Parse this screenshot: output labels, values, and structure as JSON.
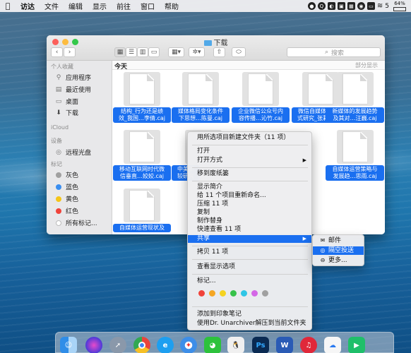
{
  "menubar": {
    "apple": "",
    "app": "访达",
    "items": [
      "文件",
      "编辑",
      "显示",
      "前往",
      "窗口",
      "帮助"
    ],
    "tray_battery_percent": "64%",
    "tray_number": "5"
  },
  "window": {
    "title": "下载",
    "search_placeholder": "搜索"
  },
  "sidebar": {
    "favorites_header": "个人收藏",
    "favorites": [
      "应用程序",
      "最近使用",
      "桌面",
      "下载"
    ],
    "icloud_header": "iCloud",
    "devices_header": "设备",
    "devices": [
      "远程光盘"
    ],
    "tags_header": "标记",
    "tags": [
      {
        "label": "灰色",
        "color": "#a0a0a0"
      },
      {
        "label": "蓝色",
        "color": "#3a8ef0"
      },
      {
        "label": "黄色",
        "color": "#f5c518"
      },
      {
        "label": "红色",
        "color": "#f0433a"
      },
      {
        "label": "所有标记...",
        "color": "#ffffff"
      }
    ]
  },
  "content": {
    "section_title": "今天",
    "section_part": "部分显示",
    "files": [
      [
        "结构_行为还是绩",
        "效_我国…李倩.caj"
      ],
      [
        "媒体格局变化条件",
        "下思想…陈曼.caj"
      ],
      [
        "企业微信公众号内",
        "容传播…沁竹.caj"
      ],
      [
        "微信自媒体运营模",
        "式研究_张莉芳.caj"
      ],
      [
        "新媒体的发展趋势",
        "及其对…汪巍.caj"
      ],
      [
        "移动互联网时代微",
        "信垂直…姣姣.caj"
      ],
      [
        "中美新",
        "较研究"
      ],
      [
        "自媒体运营策略与",
        "发展趋…思雨.caj"
      ],
      [
        "自媒体运营现状及",
        ""
      ]
    ]
  },
  "context_menu": {
    "items": [
      "用所选项目新建文件夹（11 项）",
      "打开",
      "打开方式",
      "移到废纸篓",
      "显示简介",
      "给 11 个项目重新命名...",
      "压缩 11 项",
      "复制",
      "制作替身",
      "快速查看 11 项",
      "共享",
      "拷贝 11 项",
      "查看显示选项",
      "标记...",
      "添加到印象笔记",
      "使用Dr. Unarchiver解压到当前文件夹"
    ],
    "tag_colors": [
      "#f0433a",
      "#f5a623",
      "#f5d320",
      "#37c24a",
      "#2fc6e6",
      "#d467e6",
      "#a0a0a0"
    ]
  },
  "share_submenu": {
    "items": [
      "邮件",
      "隔空投送",
      "更多..."
    ]
  },
  "dock": {
    "apps": [
      {
        "name": "finder",
        "color": "#3aa0f0"
      },
      {
        "name": "siri",
        "color": "#6a4ad8"
      },
      {
        "name": "launchpad",
        "color": "#8a98aa"
      },
      {
        "name": "chrome",
        "color": "#e8e8e8"
      },
      {
        "name": "qq-browser",
        "color": "#1d9ff0"
      },
      {
        "name": "safari",
        "color": "#3d8ee8"
      },
      {
        "name": "wechat",
        "color": "#2dc23c"
      },
      {
        "name": "qq",
        "color": "#f0f0f0"
      },
      {
        "name": "photoshop",
        "color": "#0a2a52",
        "label": "Ps"
      },
      {
        "name": "word",
        "color": "#2a5bb5",
        "label": "W"
      },
      {
        "name": "netease-music",
        "color": "#e0283a"
      },
      {
        "name": "baidu-netdisk",
        "color": "#f6f6f6"
      },
      {
        "name": "pycharm",
        "color": "#1fbf6a"
      }
    ]
  }
}
